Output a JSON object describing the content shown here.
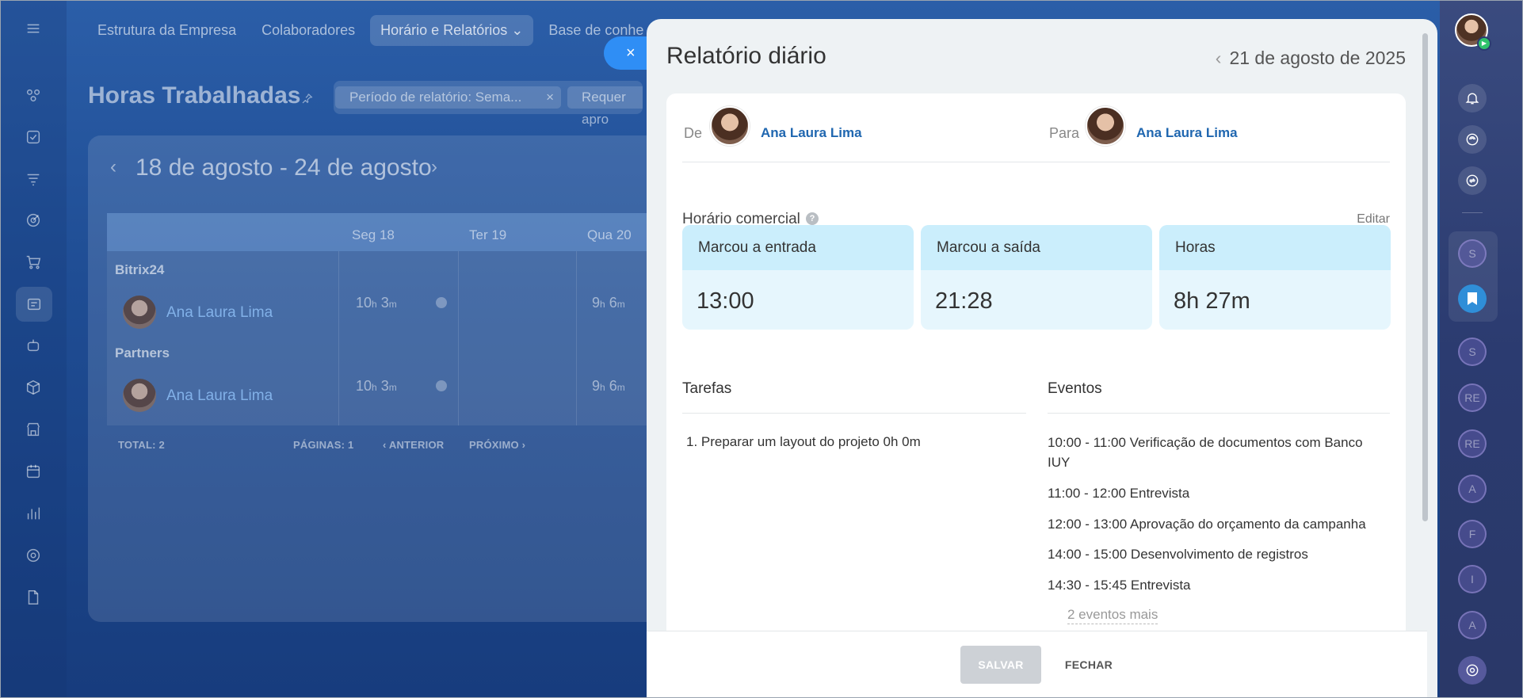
{
  "top_nav": {
    "tabs": [
      {
        "label": "Estrutura da Empresa"
      },
      {
        "label": "Colaboradores"
      },
      {
        "label": "Horário e Relatórios ⌄"
      },
      {
        "label": "Base de conhe"
      }
    ]
  },
  "page": {
    "title": "Horas Trabalhadas",
    "filter_chip_1": "Período de relatório: Sema...",
    "filter_chip_1_remove": "×",
    "filter_chip_2": "Requer apro"
  },
  "report_table": {
    "week_range": "18 de agosto - 24 de agosto",
    "prev": "‹",
    "next": "›",
    "columns": [
      "Seg 18",
      "Ter 19",
      "Qua 20"
    ],
    "groups": [
      {
        "name": "Bitrix24",
        "employee": "Ana Laura Lima",
        "mon_h": "10",
        "mon_m": "3",
        "wed_h": "9",
        "wed_m": "6"
      },
      {
        "name": "Partners",
        "employee": "Ana Laura Lima",
        "mon_h": "10",
        "mon_m": "3",
        "wed_h": "9",
        "wed_m": "6"
      }
    ],
    "unit_h": "h",
    "unit_m": "m",
    "total_label": "TOTAL: 2",
    "pages_label": "PÁGINAS:",
    "pages_value": "1",
    "prev_label": "ANTERIOR",
    "next_label": "PRÓXIMO"
  },
  "right_strip": {
    "circles": [
      "S",
      "S",
      "RE",
      "RE",
      "A",
      "F",
      "I",
      "A"
    ]
  },
  "slider": {
    "close_symbol": "×",
    "title": "Relatório diário",
    "date_prev": "‹",
    "date": "21 de agosto de 2025",
    "from_label": "De",
    "from_name": "Ana Laura Lima",
    "to_label": "Para",
    "to_name": "Ana Laura Lima",
    "business_hours_label": "Horário comercial",
    "help": "?",
    "edit_label": "Editar",
    "stats": [
      {
        "label": "Marcou a entrada",
        "value": "13:00"
      },
      {
        "label": "Marcou a saída",
        "value": "21:28"
      },
      {
        "label": "Horas",
        "value": "8h 27m"
      }
    ],
    "tasks_title": "Tarefas",
    "tasks": [
      "1. Preparar um layout do projeto 0h 0m"
    ],
    "events_title": "Eventos",
    "events": [
      "10:00 - 11:00 Verificação de documentos com Banco IUY",
      "11:00 - 12:00 Entrevista",
      "12:00 - 13:00 Aprovação do orçamento da campanha",
      "14:00 - 15:00 Desenvolvimento de registros",
      "14:30 - 15:45 Entrevista"
    ],
    "more_events": "2 eventos mais",
    "save_label": "SALVAR",
    "close_label": "FECHAR"
  }
}
